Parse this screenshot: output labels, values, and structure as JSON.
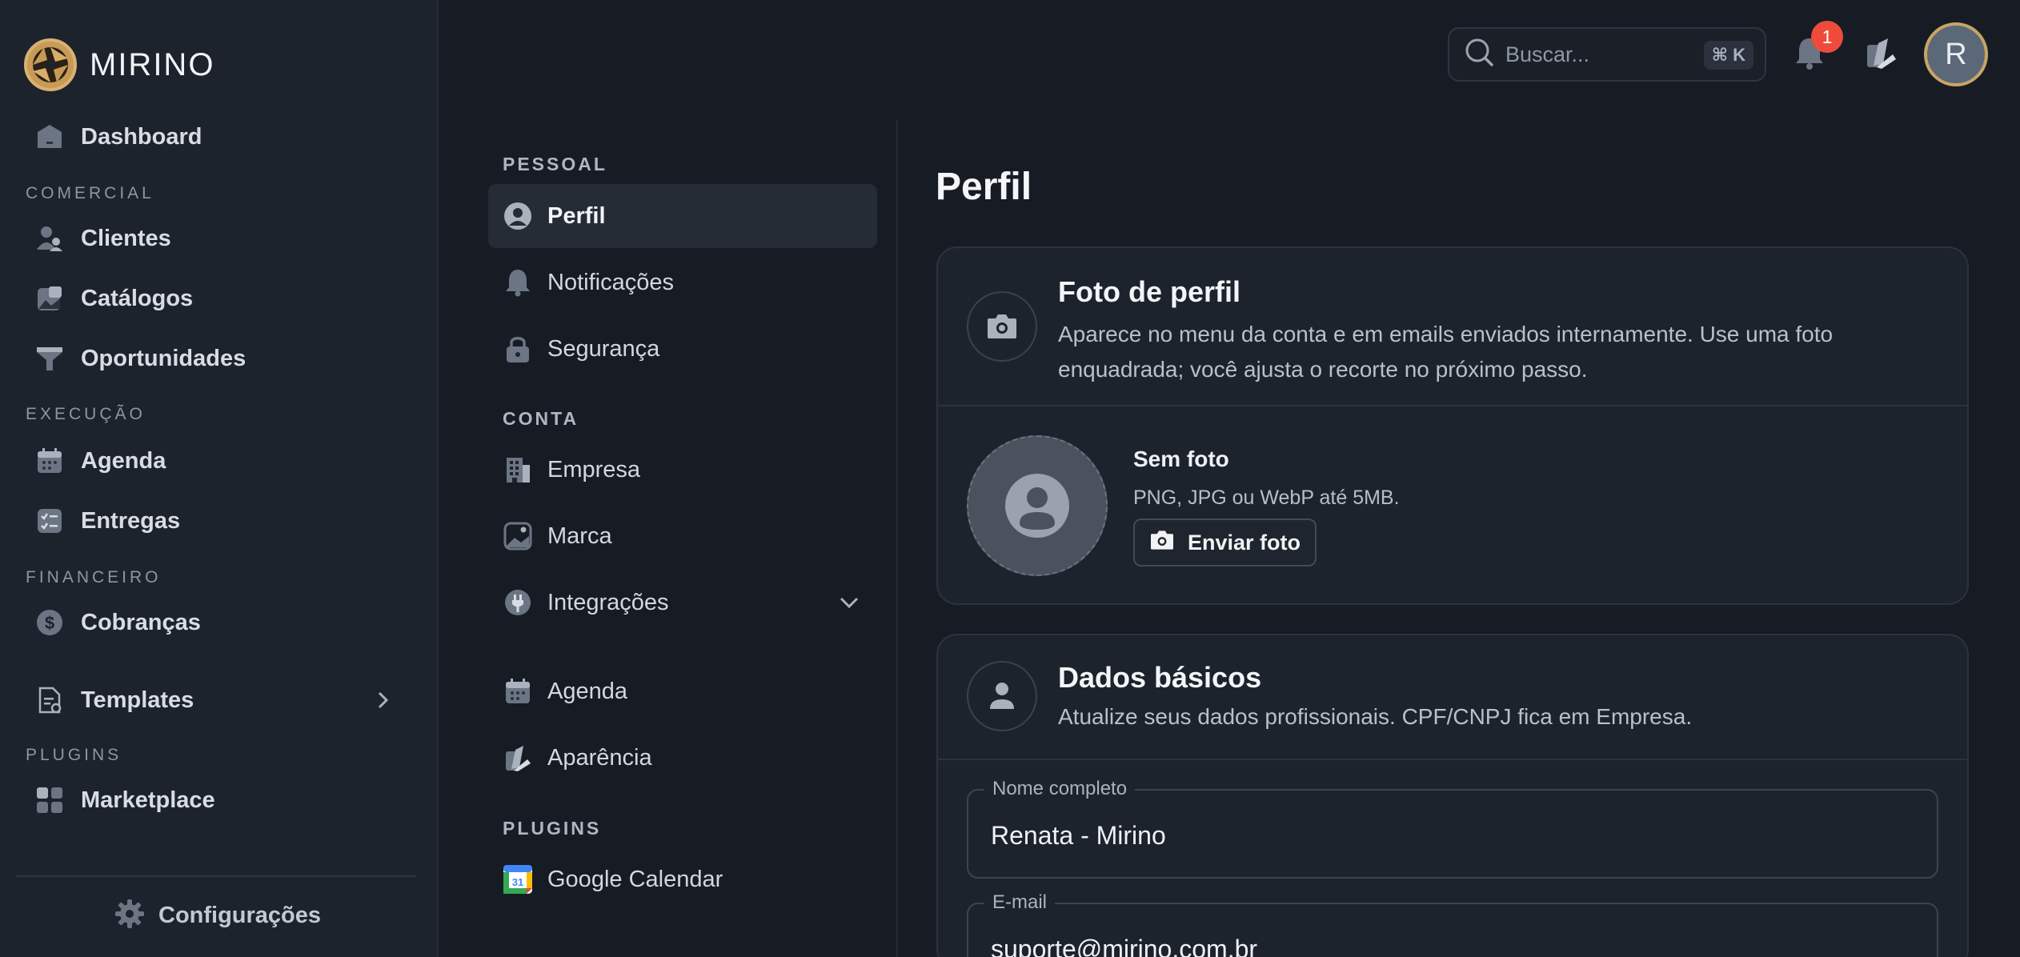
{
  "brand": {
    "name": "MIRINO",
    "accent": "#c79a55"
  },
  "sidebar": {
    "items": [
      {
        "label": "Dashboard",
        "icon": "home-icon"
      },
      {
        "section": "COMERCIAL"
      },
      {
        "label": "Clientes",
        "icon": "users-icon"
      },
      {
        "label": "Catálogos",
        "icon": "gallery-icon"
      },
      {
        "label": "Oportunidades",
        "icon": "funnel-icon"
      },
      {
        "section": "EXECUÇÃO"
      },
      {
        "label": "Agenda",
        "icon": "calendar-icon"
      },
      {
        "label": "Entregas",
        "icon": "checklist-icon"
      },
      {
        "section": "FINANCEIRO"
      },
      {
        "label": "Cobranças",
        "icon": "dollar-icon"
      },
      {
        "label": "Templates",
        "icon": "document-icon",
        "expandable": true
      },
      {
        "section": "PLUGINS"
      },
      {
        "label": "Marketplace",
        "icon": "grid-icon"
      }
    ],
    "footer": {
      "label": "Configurações",
      "icon": "gear-icon"
    }
  },
  "topbar": {
    "search_placeholder": "Buscar...",
    "shortcut": "⌘ K",
    "notifications_count": "1",
    "avatar_initial": "R"
  },
  "subnav": {
    "sections": [
      {
        "title": "PESSOAL",
        "items": [
          {
            "label": "Perfil",
            "icon": "user-circle-icon",
            "active": true
          },
          {
            "label": "Notificações",
            "icon": "bell-icon"
          },
          {
            "label": "Segurança",
            "icon": "lock-icon"
          }
        ]
      },
      {
        "title": "CONTA",
        "items": [
          {
            "label": "Empresa",
            "icon": "building-icon"
          },
          {
            "label": "Marca",
            "icon": "image-icon"
          },
          {
            "label": "Integrações",
            "icon": "plug-icon",
            "expandable": true
          },
          {
            "label": "Agenda",
            "icon": "calendar-icon"
          },
          {
            "label": "Aparência",
            "icon": "palette-icon"
          }
        ]
      },
      {
        "title": "PLUGINS",
        "items": [
          {
            "label": "Google Calendar",
            "icon": "google-calendar-icon"
          }
        ]
      }
    ]
  },
  "main": {
    "title": "Perfil",
    "photo_card": {
      "title": "Foto de perfil",
      "description_line1": "Aparece no menu da conta e em emails enviados internamente. Use uma foto",
      "description_line2": "enquadrada; você ajusta o recorte no próximo passo.",
      "status": "Sem foto",
      "formats": "PNG, JPG ou WebP até 5MB.",
      "upload_label": "Enviar foto"
    },
    "basic_card": {
      "title": "Dados básicos",
      "description": "Atualize seus dados profissionais. CPF/CNPJ fica em Empresa.",
      "fields": [
        {
          "label": "Nome completo",
          "value": "Renata - Mirino"
        },
        {
          "label": "E-mail",
          "value": "suporte@mirino.com.br"
        }
      ]
    }
  }
}
